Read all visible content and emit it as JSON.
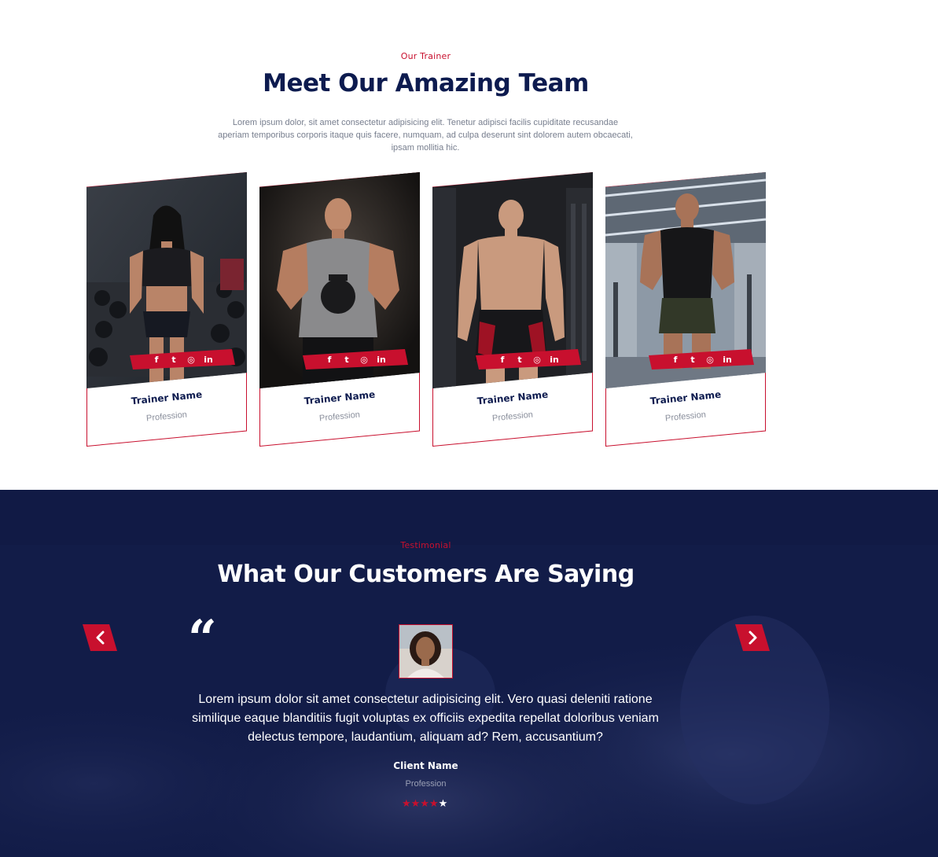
{
  "colors": {
    "accent": "#c8102e",
    "navy": "#0d1b4f",
    "muted": "#777e8e"
  },
  "team": {
    "eyebrow": "Our Trainer",
    "title": "Meet Our Amazing Team",
    "intro": "Lorem ipsum dolor, sit amet consectetur adipisicing elit. Tenetur adipisci facilis cupiditate recusandae aperiam temporibus corporis itaque quis facere, numquam, ad culpa deserunt sint dolorem autem obcaecati, ipsam mollitia hic.",
    "social_icons": [
      "facebook-icon",
      "twitter-icon",
      "instagram-icon",
      "linkedin-icon"
    ],
    "social_glyphs": [
      "f",
      "t",
      "◎",
      "in"
    ],
    "trainers": [
      {
        "name": "Trainer Name",
        "profession": "Profession",
        "photo": "female-trainer-photo"
      },
      {
        "name": "Trainer Name",
        "profession": "Profession",
        "photo": "kettlebell-trainer-photo"
      },
      {
        "name": "Trainer Name",
        "profession": "Profession",
        "photo": "shirtless-trainer-photo"
      },
      {
        "name": "Trainer Name",
        "profession": "Profession",
        "photo": "tanktop-trainer-photo"
      }
    ]
  },
  "testimonial": {
    "eyebrow": "Testimonial",
    "title": "What Our Customers Are Saying",
    "quote_glyph": "“",
    "text": "Lorem ipsum dolor sit amet consectetur adipisicing elit. Vero quasi deleniti ratione similique eaque blanditiis fugit voluptas ex officiis expedita repellat doloribus veniam delectus tempore, laudantium, aliquam ad? Rem, accusantium?",
    "client_name": "Client Name",
    "client_profession": "Profession",
    "rating": 4,
    "rating_max": 5,
    "prev_icon": "chevron-left-icon",
    "next_icon": "chevron-right-icon"
  }
}
